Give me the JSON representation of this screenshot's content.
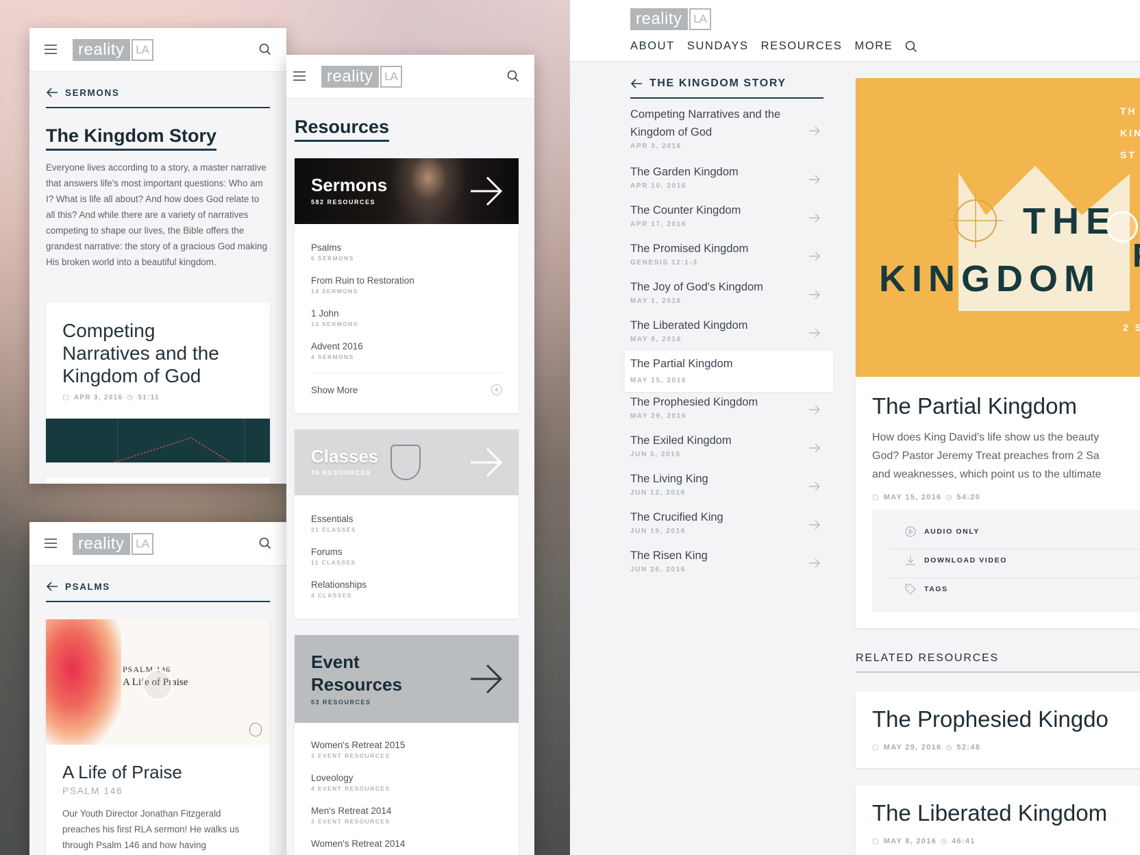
{
  "brand": {
    "logo_main": "reality",
    "logo_la": "LA"
  },
  "phone1": {
    "back_label": "SERMONS",
    "title": "The Kingdom Story",
    "description": "Everyone lives according to a story, a master narrative that answers life's most important questions: Who am I? What is life all about? And how does God relate to all this? And while there are a variety of narratives competing to shape our lives, the Bible offers the grandest narrative: the story of a gracious God making His broken world into a beautiful kingdom.",
    "card_title": "Competing Narratives and the Kingdom of God",
    "card_date": "APR 3, 2016",
    "card_duration": "51:11"
  },
  "phone2": {
    "back_label": "PSALMS",
    "art_line1": "PSALM 146",
    "art_line2": "A Life of Praise",
    "card_title": "A Life of Praise",
    "card_subtitle": "PSALM 146",
    "card_desc": "Our Youth Director Jonathan Fitzgerald preaches his first RLA sermon! He walks us through Psalm 146 and how having"
  },
  "resources": {
    "title": "Resources",
    "sermons": {
      "title": "Sermons",
      "count": "582 RESOURCES",
      "items": [
        {
          "t": "Psalms",
          "s": "6 SERMONS"
        },
        {
          "t": "From Ruin to Restoration",
          "s": "14 SERMONS"
        },
        {
          "t": "1 John",
          "s": "13 SERMONS"
        },
        {
          "t": "Advent 2016",
          "s": "4 SERMONS"
        }
      ],
      "show_more": "Show More"
    },
    "classes": {
      "title": "Classes",
      "count": "36 RESOURCES",
      "items": [
        {
          "t": "Essentials",
          "s": "21 CLASSES"
        },
        {
          "t": "Forums",
          "s": "11 CLASSES"
        },
        {
          "t": "Relationships",
          "s": "4 CLASSES"
        }
      ]
    },
    "events": {
      "title_line1": "Event",
      "title_line2": "Resources",
      "count": "53 RESOURCES",
      "items": [
        {
          "t": "Women's Retreat 2015",
          "s": "3 EVENT RESOURCES"
        },
        {
          "t": "Loveology",
          "s": "4 EVENT RESOURCES"
        },
        {
          "t": "Men's Retreat 2014",
          "s": "3 EVENT RESOURCES"
        },
        {
          "t": "Women's Retreat 2014",
          "s": ""
        }
      ]
    }
  },
  "desktop": {
    "nav": [
      "ABOUT",
      "SUNDAYS",
      "RESOURCES",
      "MORE"
    ],
    "back_label": "THE KINGDOM STORY",
    "sermons": [
      {
        "t": "Competing Narratives and the Kingdom of God",
        "d": "APR 3, 2016"
      },
      {
        "t": "The Garden Kingdom",
        "d": "APR 10, 2016"
      },
      {
        "t": "The Counter Kingdom",
        "d": "APR 17, 2016"
      },
      {
        "t": "The Promised Kingdom",
        "d": "GENESIS 12:1-3"
      },
      {
        "t": "The Joy of God's Kingdom",
        "d": "MAY 1, 2016"
      },
      {
        "t": "The Liberated Kingdom",
        "d": "MAY 8, 2016"
      },
      {
        "t": "The Partial Kingdom",
        "d": "MAY 15, 2016"
      },
      {
        "t": "The Prophesied Kingdom",
        "d": "MAY 29, 2016"
      },
      {
        "t": "The Exiled Kingdom",
        "d": "JUN 5, 2016"
      },
      {
        "t": "The Living King",
        "d": "JUN 12, 2016"
      },
      {
        "t": "The Crucified King",
        "d": "JUN 19, 2016"
      },
      {
        "t": "The Risen King",
        "d": "JUN 26, 2016"
      }
    ],
    "art": {
      "line_the": "THE",
      "line_kingdom": "KINGDOM",
      "side1": "TH",
      "side2": "KIN",
      "side3": "ST",
      "side_p": "P",
      "side_num": "2 S"
    },
    "detail_title": "The Partial Kingdom",
    "detail_desc_1": "How does King David's life show us the beauty",
    "detail_desc_2": "God? Pastor Jeremy Treat preaches from 2 Sa",
    "detail_desc_3": "and weaknesses, which point us to the ultimate",
    "detail_date": "MAY 15, 2016",
    "detail_duration": "54:20",
    "actions": [
      "AUDIO ONLY",
      "DOWNLOAD VIDEO",
      "TAGS"
    ],
    "related_heading": "RELATED RESOURCES",
    "related": [
      {
        "t": "The Prophesied Kingdo",
        "d": "MAY 29, 2016",
        "dur": "52:48"
      },
      {
        "t": "The Liberated Kingdom",
        "d": "MAY 8, 2016",
        "dur": "46:41"
      }
    ]
  },
  "colors": {
    "navy": "#1e3a4c",
    "gold": "#f3b64f",
    "cream": "#f7ecd2",
    "teal_dark": "#163a3d",
    "pink": "#e94f6b"
  }
}
